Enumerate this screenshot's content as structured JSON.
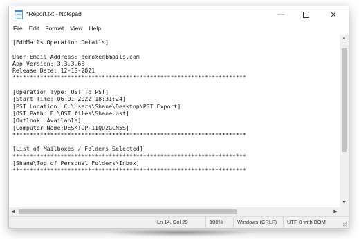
{
  "window": {
    "title": "*Report.txt - Notepad",
    "icon": "notepad-icon",
    "controls": {
      "minimize": "—",
      "close": "✕"
    }
  },
  "menu": [
    "File",
    "Edit",
    "Format",
    "View",
    "Help"
  ],
  "document": {
    "lines": [
      "[EdbMails Operation Details]",
      "",
      "User Email Address: demo@edbmails.com",
      "App Version: 3.3.3.65",
      "Release Date: 12-18-2021",
      "********************************************************************",
      "",
      "[Operation Type: OST To PST]",
      "[Start Time: 06-01-2022 18:31:24]",
      "[PST Location: C:\\Users\\Shane\\Desktop\\PST Export]",
      "[OST Path: E:\\OST files\\Shane.ost]",
      "[Outlook: Available]",
      "[Computer Name:DESKTOP-1IQD2GCN5S]",
      "********************************************************************",
      "",
      "[List of Mailboxes / Folders Selected]",
      "********************************************************************",
      "[Shane\\Top of Personal Folders\\Inbox]",
      "********************************************************************"
    ]
  },
  "status": {
    "position": "Ln 14, Col 29",
    "zoom": "100%",
    "line_ending": "Windows (CRLF)",
    "encoding": "UTF-8 with BOM"
  }
}
